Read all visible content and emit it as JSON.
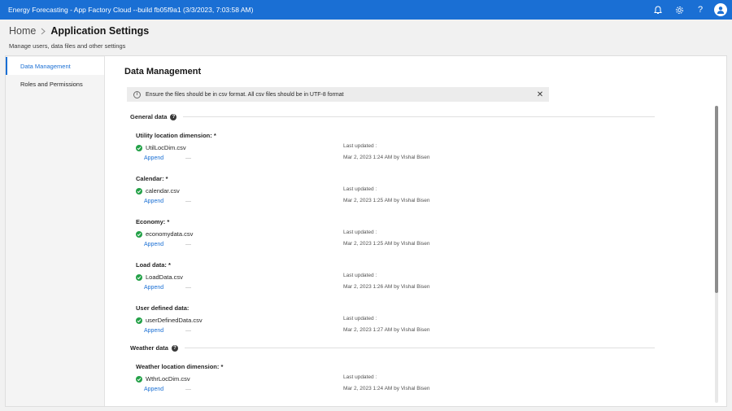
{
  "topbar": {
    "title": "Energy Forecasting - App Factory Cloud --build fb05f9a1 (3/3/2023, 7:03:58 AM)",
    "icons": [
      "notification-icon",
      "settings-icon",
      "help-icon",
      "user-avatar-icon"
    ],
    "help_glyph": "?"
  },
  "breadcrumb": {
    "home": "Home",
    "current": "Application Settings"
  },
  "subtitle": "Manage users, data files and other settings",
  "sidenav": {
    "items": [
      {
        "label": "Data Management",
        "active": true
      },
      {
        "label": "Roles and Permissions",
        "active": false
      }
    ]
  },
  "main": {
    "title": "Data Management",
    "banner": {
      "text": "Ensure the files should be in csv format. All csv files should be in UTF-8 format",
      "info_glyph": "i",
      "close_glyph": "✕"
    },
    "groups": [
      {
        "title": "General data",
        "files": [
          {
            "label": "Utility location dimension: *",
            "file": "UtilLocDim.csv",
            "action": "Append",
            "dash": "—",
            "updated_label": "Last updated :",
            "updated_value": "Mar 2, 2023 1:24 AM by Vishal Bisen"
          },
          {
            "label": "Calendar: *",
            "file": "calendar.csv",
            "action": "Append",
            "dash": "—",
            "updated_label": "Last updated :",
            "updated_value": "Mar 2, 2023 1:25 AM by Vishal Bisen"
          },
          {
            "label": "Economy: *",
            "file": "economydata.csv",
            "action": "Append",
            "dash": "—",
            "updated_label": "Last updated :",
            "updated_value": "Mar 2, 2023 1:25 AM by Vishal Bisen"
          },
          {
            "label": "Load data: *",
            "file": "LoadData.csv",
            "action": "Append",
            "dash": "—",
            "updated_label": "Last updated :",
            "updated_value": "Mar 2, 2023 1:26 AM by Vishal Bisen"
          },
          {
            "label": "User defined data:",
            "file": "userDefinedData.csv",
            "action": "Append",
            "dash": "—",
            "updated_label": "Last updated :",
            "updated_value": "Mar 2, 2023 1:27 AM by Vishal Bisen"
          }
        ]
      },
      {
        "title": "Weather data",
        "files": [
          {
            "label": "Weather location dimension: *",
            "file": "WthrLocDim.csv",
            "action": "Append",
            "dash": "—",
            "updated_label": "Last updated :",
            "updated_value": "Mar 2, 2023 1:24 AM by Vishal Bisen"
          }
        ]
      }
    ],
    "group_help_glyph": "?"
  },
  "colors": {
    "brand": "#1a6fd4",
    "success": "#24a148",
    "link": "#1a6fd4"
  }
}
